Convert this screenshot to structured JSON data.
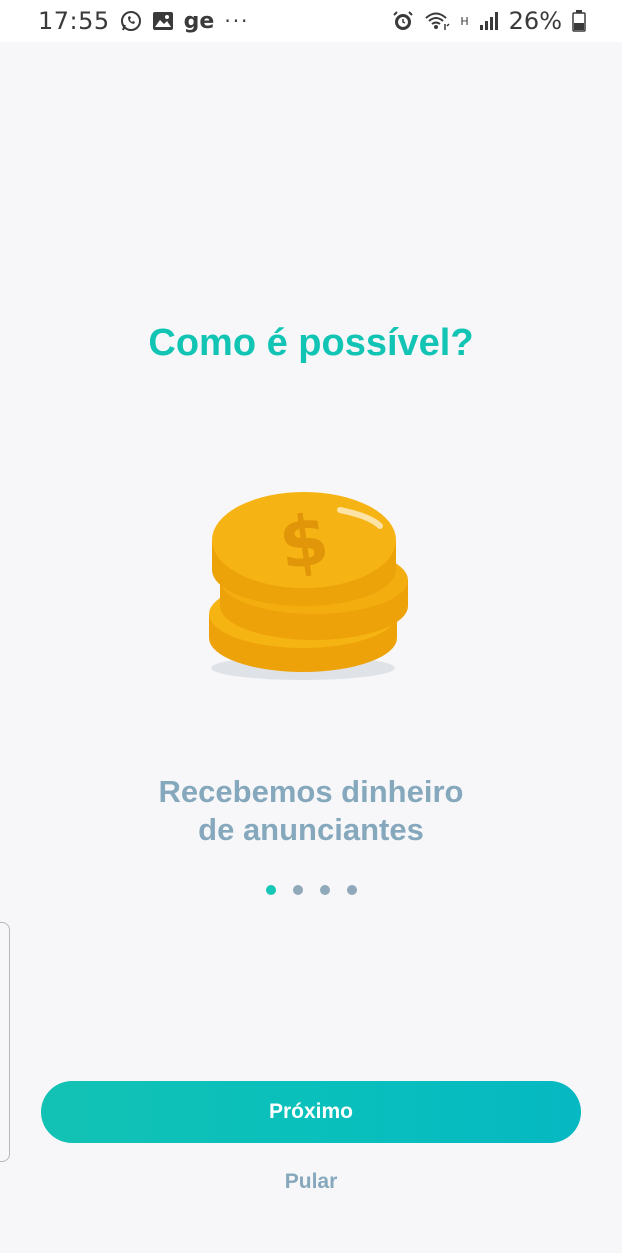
{
  "status_bar": {
    "time": "17:55",
    "ge_label": "ge",
    "more_dots": "···",
    "network_label": "H",
    "battery_percent": "26%",
    "icons": [
      "whatsapp-icon",
      "gallery-icon",
      "alarm-icon",
      "wifi-icon",
      "signal-icon",
      "battery-icon"
    ]
  },
  "onboarding": {
    "title": "Como é possível?",
    "subtitle_line1": "Recebemos dinheiro",
    "subtitle_line2": "de anunciantes",
    "page_indicator": {
      "total": 4,
      "current": 1
    },
    "next_button_label": "Próximo",
    "skip_label": "Pular"
  },
  "colors": {
    "accent": "#12c4b4",
    "subtitle": "#86a8bd",
    "coin": "#f5ac0c"
  }
}
